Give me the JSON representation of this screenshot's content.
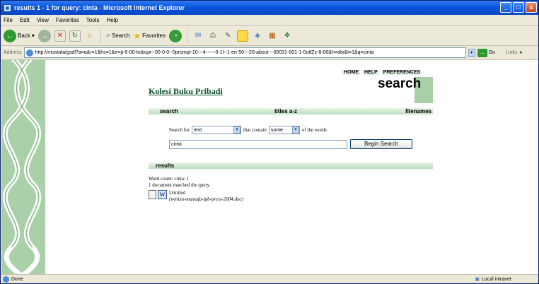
{
  "window": {
    "title": "results 1 - 1 for query: cinta - Microsoft Internet Explorer"
  },
  "menu": [
    "File",
    "Edit",
    "View",
    "Favorites",
    "Tools",
    "Help"
  ],
  "toolbar": {
    "back": "Back",
    "search": "Search",
    "favorites": "Favorites"
  },
  "address": {
    "label": "Address",
    "url": "http://mustafa/gsdl?a=q&r=1&hs=1&e=p-0-00-kobupr--00-0-0--0prompt-10---4------0-1l--1-en-50---20-about---00031-001-1-0utfZz-8-00&h=dtx&t=1&q=cinta",
    "go": "Go",
    "links": "Links"
  },
  "page": {
    "toplinks": [
      "HOME",
      "HELP",
      "PREFERENCES"
    ],
    "collection": "Kolesi Buku Pribadi",
    "big_title": "search",
    "nav": {
      "search": "search",
      "titles": "titles a-z",
      "filenames": "filenames"
    },
    "form": {
      "search_for": "Search for",
      "field_value": "text",
      "that_contain": "that contain",
      "some_value": "some",
      "of_the_words": "of the words",
      "query": "cinta",
      "button": "Begin Search"
    },
    "results_header": "results",
    "word_count": "Word count: cinta: 1",
    "matched": "1 document matched the query.",
    "doc_title": "Untitled",
    "doc_file": "(winisis-mustafa-ipb-press-2004.doc)"
  },
  "status": {
    "left": "Done",
    "zone": "Local intranet"
  }
}
